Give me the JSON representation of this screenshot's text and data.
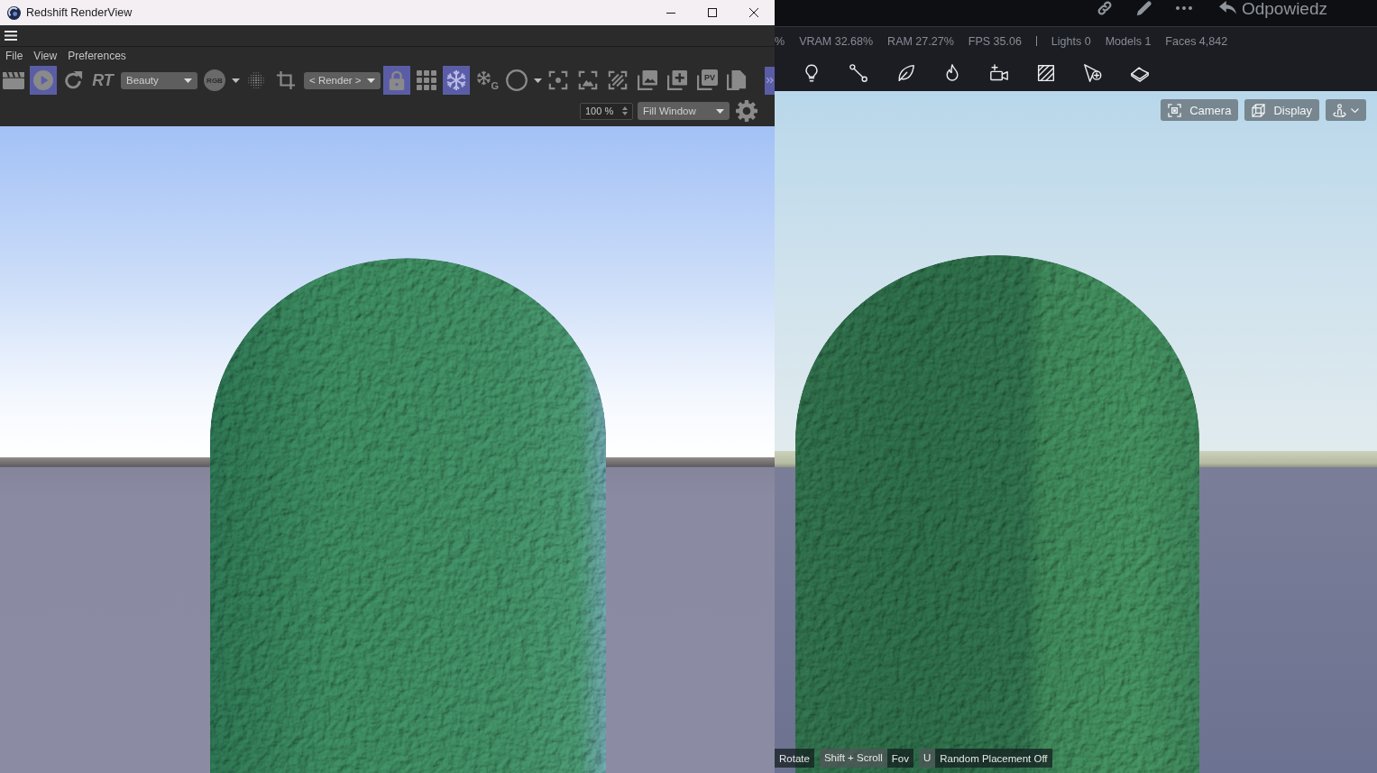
{
  "render_view": {
    "window": {
      "title": "Redshift RenderView"
    },
    "menu": [
      "File",
      "View",
      "Preferences"
    ],
    "toolbar": [
      {
        "kind": "toggle",
        "on": false
      },
      {
        "kind": "toggle",
        "on": true
      },
      {
        "kind": "toggle",
        "on": false
      },
      {
        "kind": "text",
        "label": "RT"
      },
      {
        "kind": "dropdown",
        "value": "Beauty"
      },
      {
        "kind": "menu",
        "label": "RGB"
      },
      {
        "kind": "toggle",
        "on": false
      },
      {
        "kind": "toggle",
        "on": false
      },
      {
        "kind": "dropdown",
        "value": "< Render >"
      },
      {
        "kind": "toggle",
        "on": true
      },
      {
        "kind": "toggle",
        "on": false
      },
      {
        "kind": "toggle",
        "on": true
      },
      {
        "kind": "toggle",
        "on": false,
        "label": "G"
      },
      {
        "kind": "menu"
      },
      {
        "kind": "toggle",
        "on": false
      },
      {
        "kind": "toggle",
        "on": false
      },
      {
        "kind": "toggle",
        "on": false
      },
      {
        "kind": "toggle",
        "on": false
      },
      {
        "kind": "toggle",
        "on": false
      },
      {
        "kind": "toggle",
        "on": false,
        "label": "PV"
      },
      {
        "kind": "toggle",
        "on": false
      }
    ],
    "zoom": "100 %",
    "fit": "Fill Window"
  },
  "viewer": {
    "reply": "Odpowiedz",
    "stats": [
      {
        "kind": "stat",
        "text": "%"
      },
      {
        "kind": "stat",
        "text": "VRAM 32.68%"
      },
      {
        "kind": "stat",
        "text": "RAM 27.27%"
      },
      {
        "kind": "stat",
        "text": "FPS 35.06"
      },
      {
        "kind": "divider"
      },
      {
        "kind": "stat",
        "text": "Lights 0"
      },
      {
        "kind": "stat",
        "text": "Models 1"
      },
      {
        "kind": "stat",
        "text": "Faces 4,842"
      }
    ],
    "view_buttons": [
      {
        "kind": "labeled",
        "label": "Camera"
      },
      {
        "kind": "labeled",
        "label": "Display"
      },
      {
        "kind": "menu"
      }
    ],
    "hints": [
      {
        "action": "Rotate"
      },
      {
        "key": "Shift + Scroll",
        "action": "Fov"
      },
      {
        "key": "U",
        "action": "Random Placement Off"
      }
    ]
  }
}
